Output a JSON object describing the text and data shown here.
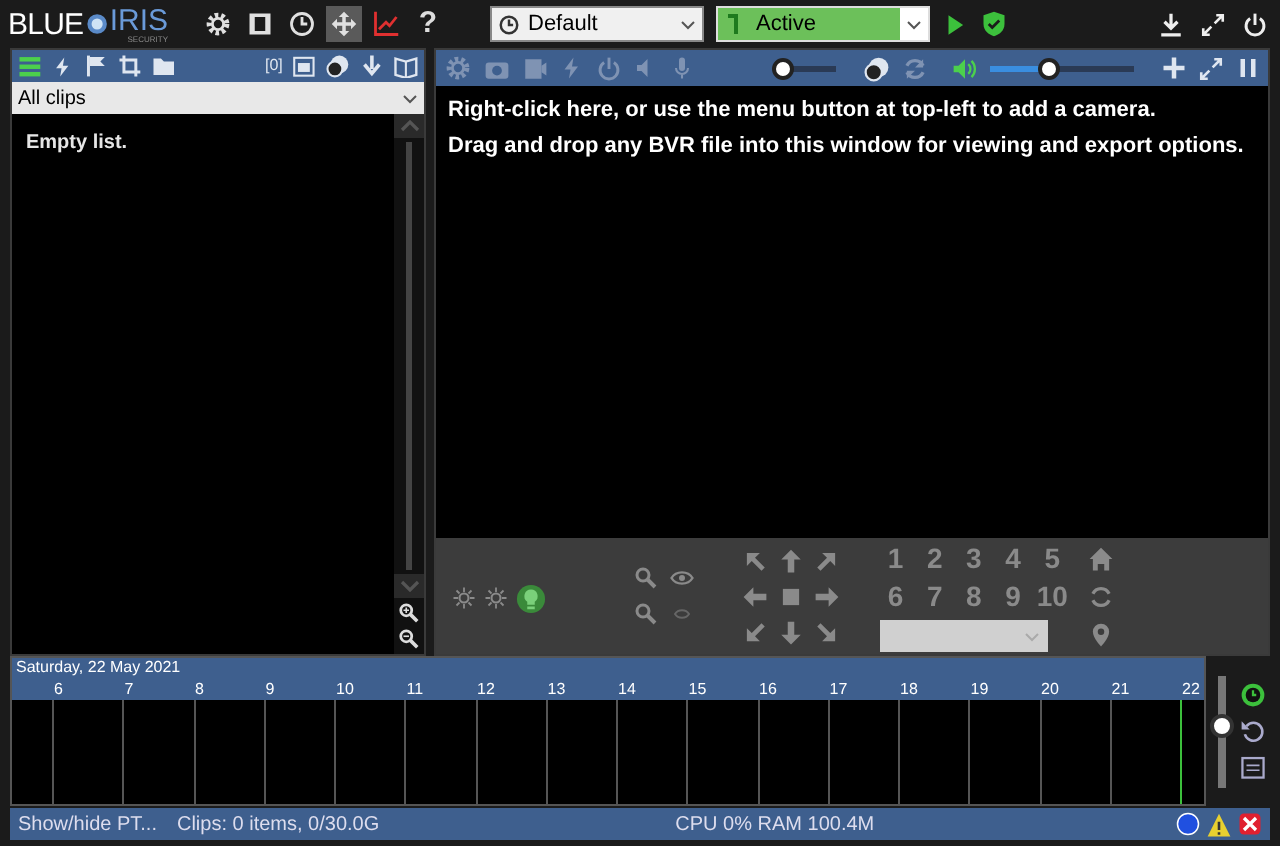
{
  "logo": {
    "left": "BLUE",
    "right": "IRIS",
    "tagline": "SECURITY"
  },
  "toolbar": [
    {
      "kind": "gear",
      "selected": false
    },
    {
      "kind": "film",
      "selected": false
    },
    {
      "kind": "clock",
      "selected": false
    },
    {
      "kind": "move",
      "selected": true
    },
    {
      "kind": "chart",
      "selected": false
    },
    {
      "kind": "help",
      "label": "?",
      "selected": false
    }
  ],
  "profile": {
    "value": "Default"
  },
  "schedule": {
    "value": "Active"
  },
  "clips_panel": {
    "count": "[0]",
    "filter": "All clips",
    "empty_text": "Empty list."
  },
  "camera_toolbar": {
    "zoom": {
      "level": 0.1
    },
    "volume": {
      "level": 0.4
    }
  },
  "message": [
    "Right-click here, or use the menu button at top-left to add a camera.",
    "Drag and drop any BVR file into this window for viewing and export options."
  ],
  "ptz": {
    "presets": [
      "1",
      "2",
      "3",
      "4",
      "5",
      "6",
      "7",
      "8",
      "9",
      "10"
    ]
  },
  "timeline": {
    "date": "Saturday, 22 May 2021",
    "hours": [
      "6",
      "7",
      "8",
      "9",
      "10",
      "11",
      "12",
      "13",
      "14",
      "15",
      "16",
      "17",
      "18",
      "19",
      "20",
      "21",
      "22"
    ],
    "level": 0.55
  },
  "status_bar": {
    "ptz_toggle": "Show/hide PT...",
    "clips": "Clips: 0 items, 0/30.0G",
    "resources": "CPU 0% RAM 100.4M"
  }
}
